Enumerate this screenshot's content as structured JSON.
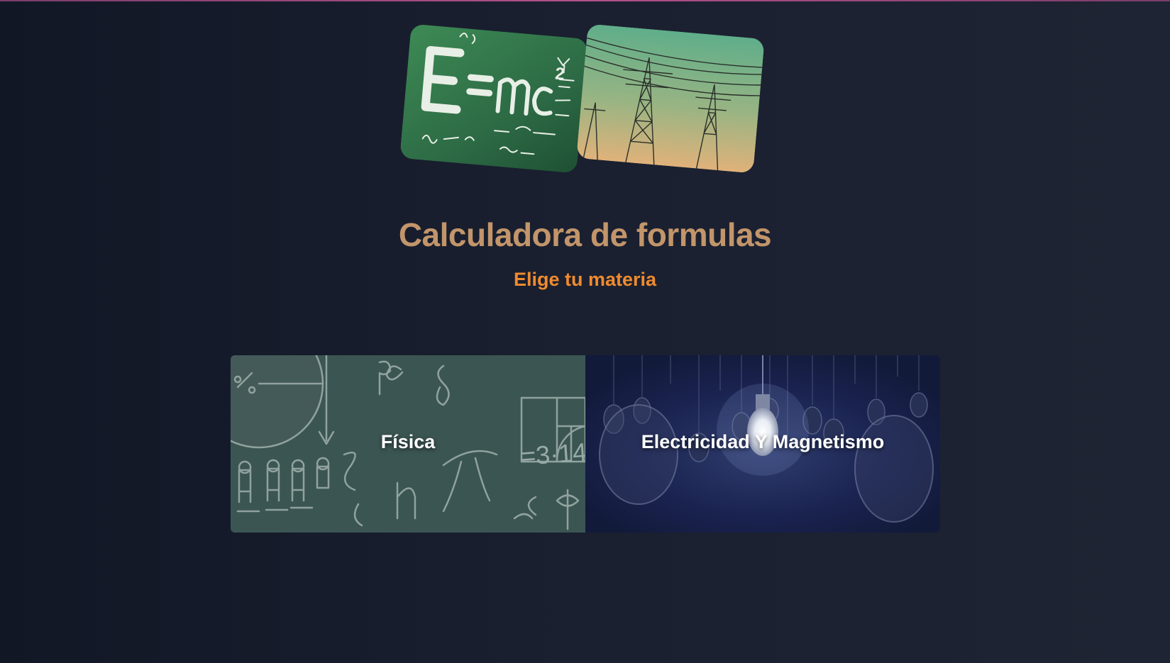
{
  "header": {
    "title": "Calculadora de formulas",
    "subtitle": "Elige tu materia"
  },
  "hero": {
    "images": [
      {
        "name": "physics-chalkboard-image",
        "formula_text": "E=mc²"
      },
      {
        "name": "power-lines-image"
      }
    ]
  },
  "subjects": [
    {
      "label": "Física"
    },
    {
      "label": "Electricidad Y Magnetismo"
    }
  ],
  "colors": {
    "background": "#161b2a",
    "title": "#c2956a",
    "subtitle": "#f08a2e",
    "accent_line": "#b4508c"
  }
}
